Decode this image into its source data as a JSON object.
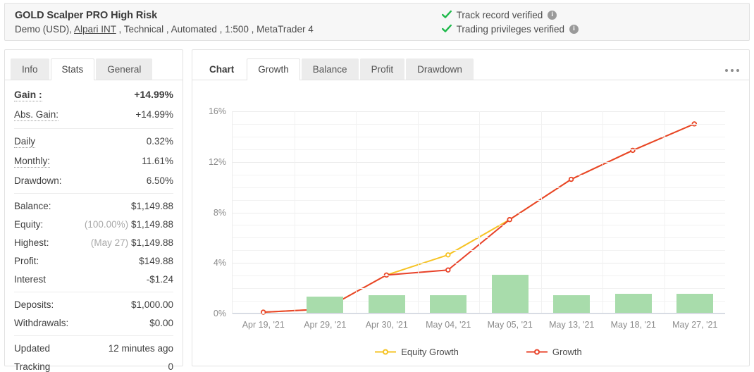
{
  "header": {
    "title": "GOLD Scalper PRO High Risk",
    "subtitle_pre": "Demo (USD), ",
    "broker_link": "Alpari INT",
    "subtitle_post": " , Technical , Automated , 1:500 , MetaTrader 4",
    "verifications": [
      {
        "label": "Track record verified",
        "info": "i"
      },
      {
        "label": "Trading privileges verified",
        "info": "i"
      }
    ]
  },
  "left_panel": {
    "tabs": [
      {
        "label": "Info",
        "active": false
      },
      {
        "label": "Stats",
        "active": true
      },
      {
        "label": "General",
        "active": false
      }
    ],
    "rows": [
      {
        "label": "Gain :",
        "value": "+14.99%"
      },
      {
        "label": "Abs. Gain:",
        "value": "+14.99%"
      },
      {
        "label": "Daily",
        "value": "0.32%"
      },
      {
        "label": "Monthly:",
        "value": "11.61%"
      },
      {
        "label": "Drawdown:",
        "value": "6.50%"
      },
      {
        "label": "Balance:",
        "value": "$1,149.88"
      },
      {
        "label": "Equity:",
        "prefix": "(100.00%)",
        "value": "$1,149.88"
      },
      {
        "label": "Highest:",
        "prefix": "(May 27)",
        "value": "$1,149.88"
      },
      {
        "label": "Profit:",
        "value": "$149.88"
      },
      {
        "label": "Interest",
        "value": "-$1.24"
      },
      {
        "label": "Deposits:",
        "value": "$1,000.00"
      },
      {
        "label": "Withdrawals:",
        "value": "$0.00"
      },
      {
        "label": "Updated",
        "value": "12 minutes ago"
      },
      {
        "label": "Tracking",
        "value": "0"
      }
    ]
  },
  "right_panel": {
    "tabs": [
      {
        "label": "Chart",
        "active": false,
        "plain": true
      },
      {
        "label": "Growth",
        "active": true
      },
      {
        "label": "Balance",
        "active": false
      },
      {
        "label": "Profit",
        "active": false
      },
      {
        "label": "Drawdown",
        "active": false
      }
    ],
    "menu_icon": "ellipsis-icon"
  },
  "colors": {
    "growth_line": "#e8432a",
    "equity_line": "#f6c324",
    "bar": "#a8dcab",
    "positive": "#15a33c",
    "axis": "#c8cedd"
  },
  "chart_data": {
    "type": "line",
    "title": "Growth",
    "xlabel": "",
    "ylabel": "",
    "ylim": [
      0,
      16
    ],
    "yticks": [
      0,
      4,
      8,
      12,
      16
    ],
    "ytick_labels": [
      "0%",
      "4%",
      "8%",
      "12%",
      "16%"
    ],
    "grid": true,
    "legend_position": "bottom",
    "categories": [
      "Apr 19, '21",
      "Apr 29, '21",
      "Apr 30, '21",
      "May 04, '21",
      "May 05, '21",
      "May 13, '21",
      "May 18, '21",
      "May 27, '21"
    ],
    "series": [
      {
        "name": "Equity Growth",
        "type": "line",
        "color": "#f6c324",
        "values": [
          0.05,
          0.3,
          3.0,
          4.6,
          7.4,
          10.6,
          12.9,
          15.0
        ]
      },
      {
        "name": "Growth",
        "type": "line",
        "color": "#e8432a",
        "values": [
          0.05,
          0.3,
          3.0,
          3.4,
          7.4,
          10.6,
          12.9,
          15.0
        ]
      },
      {
        "name": "Monthly bars",
        "type": "bar",
        "color": "#a8dcab",
        "values": [
          0,
          1.3,
          1.4,
          1.4,
          3.0,
          1.4,
          1.5,
          1.5
        ]
      }
    ]
  }
}
